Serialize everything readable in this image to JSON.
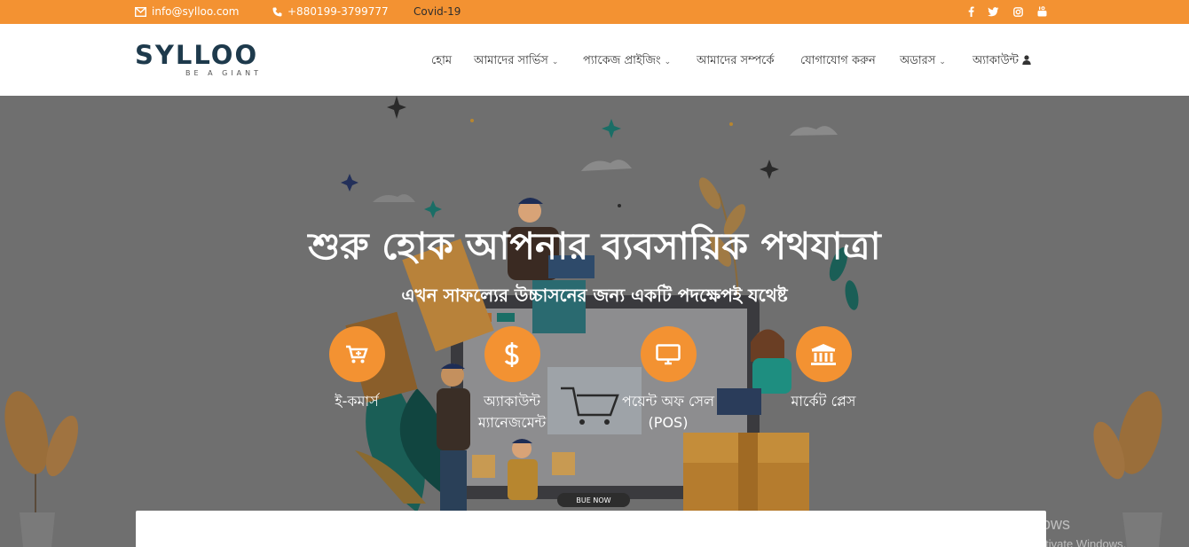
{
  "topbar": {
    "email": "info@sylloo.com",
    "phone": "+880199-3799777",
    "covid": "Covid-19",
    "social": [
      "facebook-icon",
      "twitter-icon",
      "instagram-icon",
      "youtube-icon"
    ],
    "bg_color": "#f39232"
  },
  "brand": {
    "name": "SYLLOO",
    "tagline": "BE A GIANT",
    "primary_color": "#1e3a4c",
    "accent_color": "#f39232"
  },
  "nav": {
    "home": "হোম",
    "services": "আমাদের সার্ভিস",
    "packages": "প্যাকেজ প্রাইজিং",
    "about": "আমাদের সম্পর্কে",
    "contact": "যোগাযোগ করুন",
    "orders": "অডারস",
    "account": "অ্যাকাউন্ট"
  },
  "hero": {
    "title": "শুরু হোক আপনার ব্যবসায়িক পথযাত্রা",
    "subtitle": "এখন সাফল্যের উচ্চাসনের জন্য একটি পদক্ষেপই যথেষ্ট",
    "illustration_button": "BUE NOW",
    "features": [
      {
        "icon": "cart-icon",
        "line1": "ই-কমার্স",
        "line2": ""
      },
      {
        "icon": "dollar-icon",
        "line1": "অ্যাকাউন্ট",
        "line2": "ম্যানেজমেন্ট"
      },
      {
        "icon": "monitor-icon",
        "line1": "পয়েন্ট অফ সেল",
        "line2": "(POS)"
      },
      {
        "icon": "bank-icon",
        "line1": "মার্কেট প্লেস",
        "line2": ""
      }
    ]
  },
  "watermark": {
    "line1": "Activate Windows",
    "line2": "Go to Settings to activate Windows."
  }
}
